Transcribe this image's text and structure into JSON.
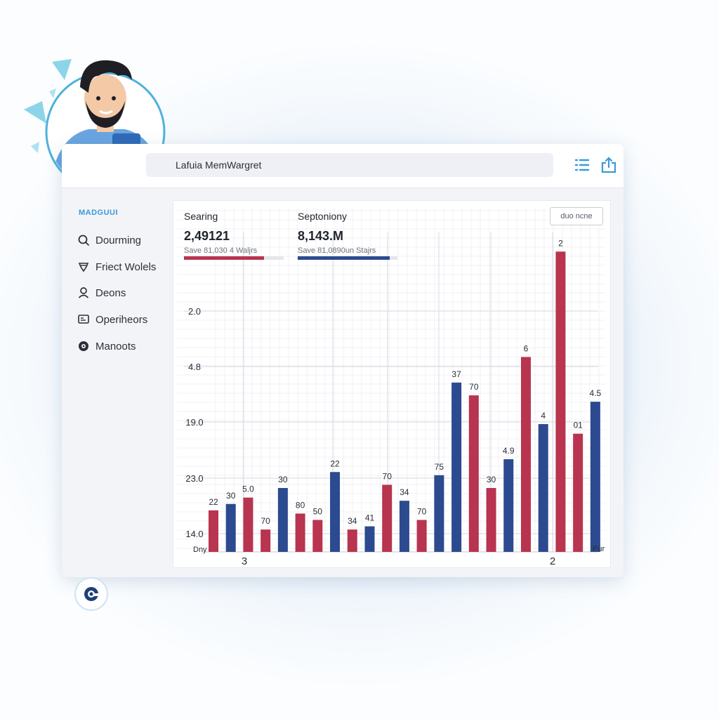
{
  "window": {
    "title": "Lafuia MemWargret"
  },
  "sidebar": {
    "heading": "MADGUUI",
    "items": [
      {
        "label": "Dourming",
        "icon": "search-icon"
      },
      {
        "label": "Friect Wolels",
        "icon": "shield-icon"
      },
      {
        "label": "Deons",
        "icon": "user-icon"
      },
      {
        "label": "Operiheors",
        "icon": "message-icon"
      },
      {
        "label": "Manoots",
        "icon": "gear-icon"
      }
    ]
  },
  "stats": [
    {
      "label": "Searing",
      "value": "2,49121",
      "sub": "Save 81,030 4 Waljrs",
      "progress": 0.8,
      "color": "#b8344f"
    },
    {
      "label": "Septoniony",
      "value": "8,143.M",
      "sub": "Save 81,0890un Stajrs",
      "progress": 0.92,
      "color": "#2c4a8f"
    }
  ],
  "chart_button_label": "duo ncne",
  "colors": {
    "red": "#b8344f",
    "blue": "#2c4a8f",
    "accent": "#3b9ad8"
  },
  "chart_data": {
    "type": "bar",
    "y_tick_labels": [
      "2.0",
      "4.8",
      "19.0",
      "23.0",
      "14.0"
    ],
    "x_left_label": "Dny",
    "x_right_label": "Pur",
    "x_tick_labels": [
      "3",
      "2"
    ],
    "grid": true,
    "ylim": [
      0,
      1
    ],
    "bars": [
      {
        "label": "22",
        "color": "red",
        "value": 0.13
      },
      {
        "label": "30",
        "color": "blue",
        "value": 0.15
      },
      {
        "label": "5.0",
        "color": "red",
        "value": 0.17
      },
      {
        "label": "70",
        "color": "red",
        "value": 0.07
      },
      {
        "label": "30",
        "color": "blue",
        "value": 0.2
      },
      {
        "label": "80",
        "color": "red",
        "value": 0.12
      },
      {
        "label": "50",
        "color": "red",
        "value": 0.1
      },
      {
        "label": "22",
        "color": "blue",
        "value": 0.25
      },
      {
        "label": "34",
        "color": "red",
        "value": 0.07
      },
      {
        "label": "41",
        "color": "blue",
        "value": 0.08
      },
      {
        "label": "70",
        "color": "red",
        "value": 0.21
      },
      {
        "label": "34",
        "color": "blue",
        "value": 0.16
      },
      {
        "label": "70",
        "color": "red",
        "value": 0.1
      },
      {
        "label": "75",
        "color": "blue",
        "value": 0.24
      },
      {
        "label": "37",
        "color": "blue",
        "value": 0.53
      },
      {
        "label": "70",
        "color": "red",
        "value": 0.49
      },
      {
        "label": "30",
        "color": "red",
        "value": 0.2
      },
      {
        "label": "4.9",
        "color": "blue",
        "value": 0.29
      },
      {
        "label": "6",
        "color": "red",
        "value": 0.61
      },
      {
        "label": "4",
        "color": "blue",
        "value": 0.4
      },
      {
        "label": "2",
        "color": "red",
        "value": 0.94
      },
      {
        "label": "01",
        "color": "red",
        "value": 0.37
      },
      {
        "label": "4.5",
        "color": "blue",
        "value": 0.47
      }
    ]
  }
}
